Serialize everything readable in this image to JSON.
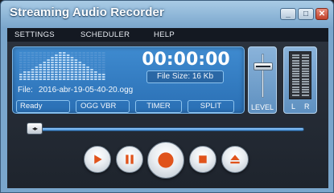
{
  "window": {
    "title": "Streaming Audio Recorder",
    "controls": {
      "minimize": "_",
      "maximize": "□",
      "close": "✕"
    }
  },
  "menu": {
    "items": [
      "SETTINGS",
      "SCHEDULER",
      "HELP"
    ]
  },
  "display": {
    "time": "00:00:00",
    "file_size": "File Size: 16 Kb",
    "file_label": "File:",
    "file_name": "2016-abr-19-05-40-20.ogg",
    "status": "Ready",
    "format": "OGG VBR",
    "timer_label": "TIMER",
    "split_label": "SPLIT"
  },
  "level": {
    "label": "LEVEL",
    "value_fraction": 0.75
  },
  "meter": {
    "left_label": "L",
    "right_label": "R",
    "left_level": 0.0,
    "right_level": 0.0
  },
  "seek": {
    "position_fraction": 0.0
  },
  "transport": {
    "icons": [
      "play-icon",
      "pause-icon",
      "record-icon",
      "stop-icon",
      "eject-icon"
    ],
    "accent": "#e0531b"
  },
  "colors": {
    "lcd": "#3585c9",
    "accent": "#e0531b",
    "titlebar": "#8fb7d8"
  }
}
